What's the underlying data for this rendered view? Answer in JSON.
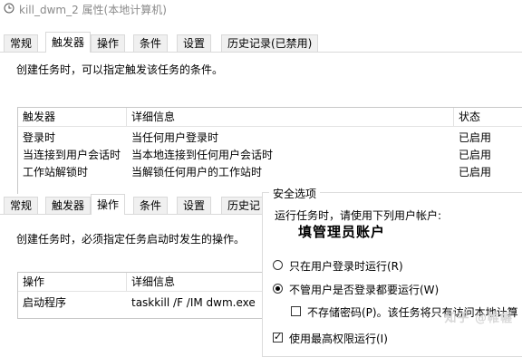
{
  "window": {
    "title": "kill_dwm_2 属性(本地计算机)"
  },
  "tabs_top": [
    "常规",
    "触发器",
    "操作",
    "条件",
    "设置",
    "历史记录(已禁用)"
  ],
  "tabs_bottom": [
    "常规",
    "触发器",
    "操作",
    "条件",
    "设置",
    "历史记"
  ],
  "triggers": {
    "hint": "创建任务时，可以指定触发该任务的条件。",
    "columns": [
      "触发器",
      "详细信息",
      "状态"
    ],
    "rows": [
      {
        "trigger": "登录时",
        "detail": "当任何用户登录时",
        "status": "已启用"
      },
      {
        "trigger": "当连接到用户会话时",
        "detail": "当本地连接到任何用户会话时",
        "status": "已启用"
      },
      {
        "trigger": "工作站解锁时",
        "detail": "当解锁任何用户的工作站时",
        "status": "已启用"
      }
    ]
  },
  "actions": {
    "hint": "创建任务时，必须指定任务启动时发生的操作。",
    "columns": [
      "操作",
      "详细信息"
    ],
    "rows": [
      {
        "action": "启动程序",
        "detail": "taskkill /F /IM dwm.exe"
      }
    ]
  },
  "security": {
    "group_title": "安全选项",
    "run_as_prompt": "运行任务时，请使用下列用户帐户:",
    "account": "填管理员账户",
    "option_logged_on": "只在用户登录时运行(R)",
    "option_always": "不管用户是否登录都要运行(W)",
    "option_no_password": "不存储密码(P)。该任务将只有访问本地计算",
    "option_highest": "使用最高权限运行(I)"
  },
  "watermark": "知乎 @帷幄"
}
